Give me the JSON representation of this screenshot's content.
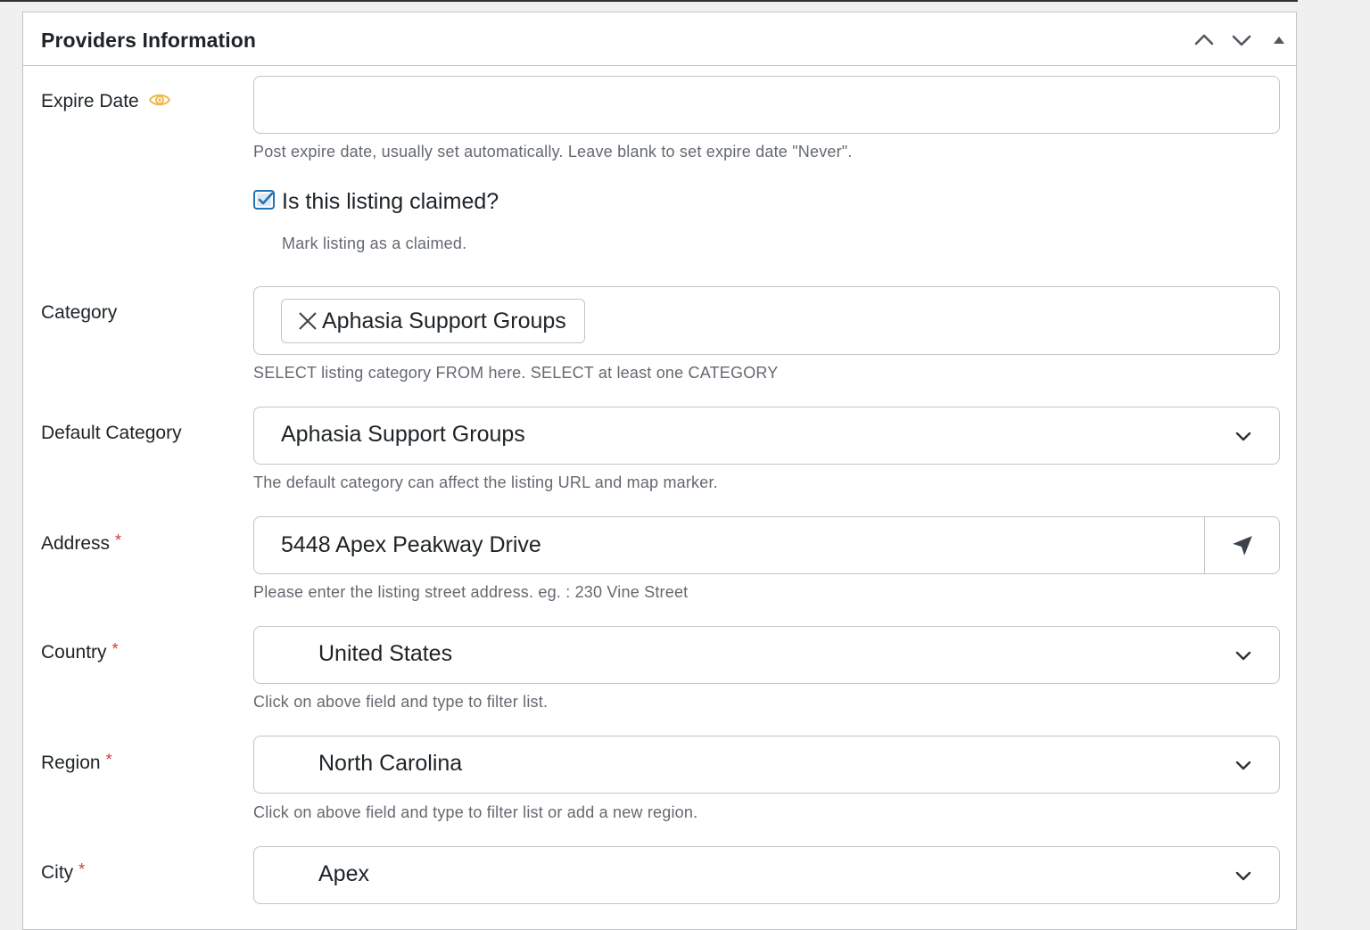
{
  "panel": {
    "title": "Providers Information"
  },
  "expire_date": {
    "label": "Expire Date",
    "value": "",
    "placeholder": "",
    "description": "Post expire date, usually set automatically. Leave blank to set expire date \"Never\"."
  },
  "claimed": {
    "checked": true,
    "label": "Is this listing claimed?",
    "description": "Mark listing as a claimed."
  },
  "category": {
    "label": "Category",
    "selected_tag": "Aphasia Support Groups",
    "description": "SELECT listing category FROM here. SELECT at least one CATEGORY"
  },
  "default_category": {
    "label": "Default Category",
    "value": "Aphasia Support Groups",
    "description": "The default category can affect the listing URL and map marker."
  },
  "address": {
    "label": "Address",
    "required_mark": "*",
    "value": "5448 Apex Peakway Drive",
    "description": "Please enter the listing street address. eg. : 230 Vine Street"
  },
  "country": {
    "label": "Country",
    "required_mark": "*",
    "value": "United States",
    "description": "Click on above field and type to filter list."
  },
  "region": {
    "label": "Region",
    "required_mark": "*",
    "value": "North Carolina",
    "description": "Click on above field and type to filter list or add a new region."
  },
  "city": {
    "label": "City",
    "required_mark": "*",
    "value": "Apex"
  },
  "colors": {
    "eye_icon": "#f0b849",
    "checkbox": "#2271b1",
    "required": "#d63638",
    "border": "#c3c4c7",
    "description_text": "#646970"
  },
  "icons": {
    "move_up": "chevron-up-icon",
    "move_down": "chevron-down-icon",
    "collapse": "triangle-up-icon",
    "visibility": "eye-icon",
    "remove_tag": "close-icon",
    "locate": "location-arrow-icon"
  }
}
